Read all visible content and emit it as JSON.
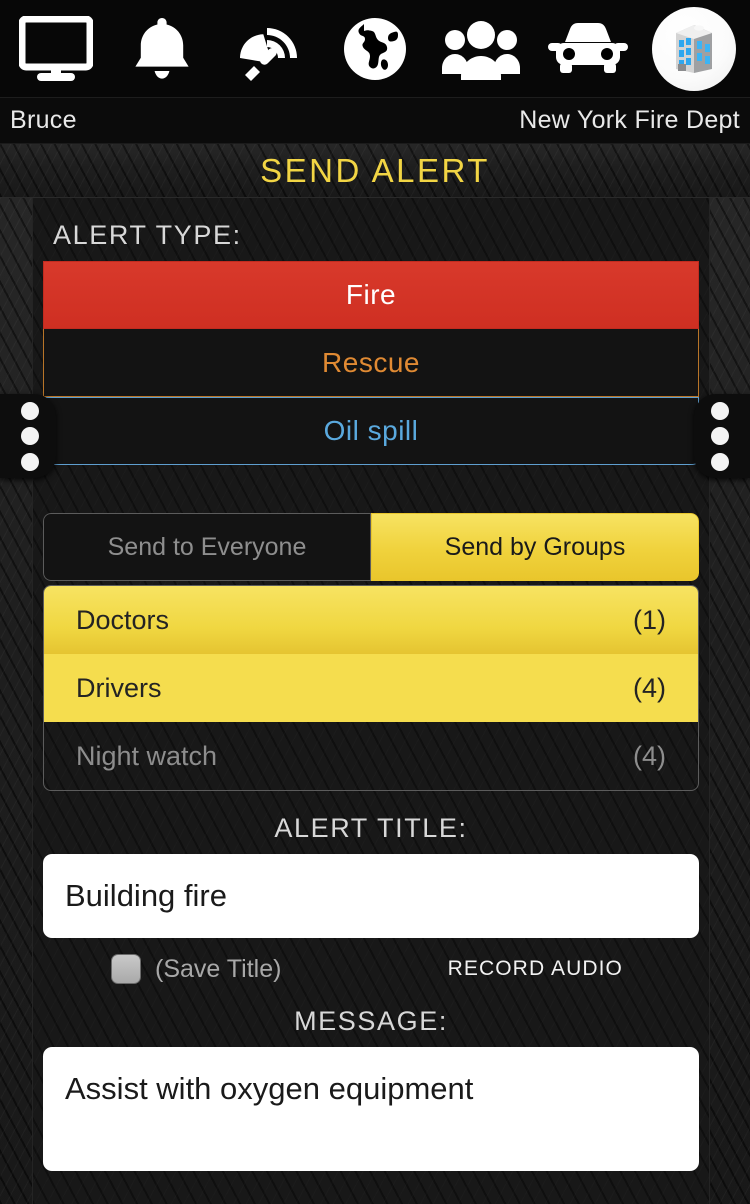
{
  "toolbar": {
    "icons": [
      {
        "name": "monitor-icon",
        "label": "Dashboard"
      },
      {
        "name": "bell-icon",
        "label": "Alerts"
      },
      {
        "name": "satellite-icon",
        "label": "Broadcast"
      },
      {
        "name": "globe-icon",
        "label": "Map"
      },
      {
        "name": "users-icon",
        "label": "Personnel"
      },
      {
        "name": "car-icon",
        "label": "Vehicles"
      }
    ],
    "avatar": {
      "name": "building-avatar-icon",
      "label": "Organization"
    }
  },
  "namebar": {
    "user": "Bruce",
    "organization": "New York Fire Dept"
  },
  "header": {
    "title": "SEND ALERT",
    "title_color": "#f2d544"
  },
  "handles": {
    "left": "left-drawer-handle",
    "right": "right-drawer-handle"
  },
  "alert_type": {
    "label": "ALERT TYPE:",
    "options": [
      {
        "label": "Fire",
        "selected": true,
        "color": "#cf2f22"
      },
      {
        "label": "Rescue",
        "selected": false,
        "color": "#e08a33"
      },
      {
        "label": "Oil spill",
        "selected": false,
        "color": "#5aa9de"
      }
    ]
  },
  "send_mode": {
    "everyone_label": "Send to Everyone",
    "groups_label": "Send by Groups",
    "selected": "Send by Groups",
    "active_color": "#f0d23c"
  },
  "groups": [
    {
      "name": "Doctors",
      "count": "(1)",
      "selected": true
    },
    {
      "name": "Drivers",
      "count": "(4)",
      "selected": true
    },
    {
      "name": "Night watch",
      "count": "(4)",
      "selected": false
    }
  ],
  "alert_title": {
    "label": "ALERT TITLE:",
    "value": "Building fire",
    "placeholder": "Alert title"
  },
  "save_title": {
    "label": "(Save Title)",
    "checked": false
  },
  "record_audio": {
    "label": "RECORD AUDIO"
  },
  "message": {
    "label": "MESSAGE:",
    "value": "Assist with oxygen equipment",
    "placeholder": "Message"
  }
}
